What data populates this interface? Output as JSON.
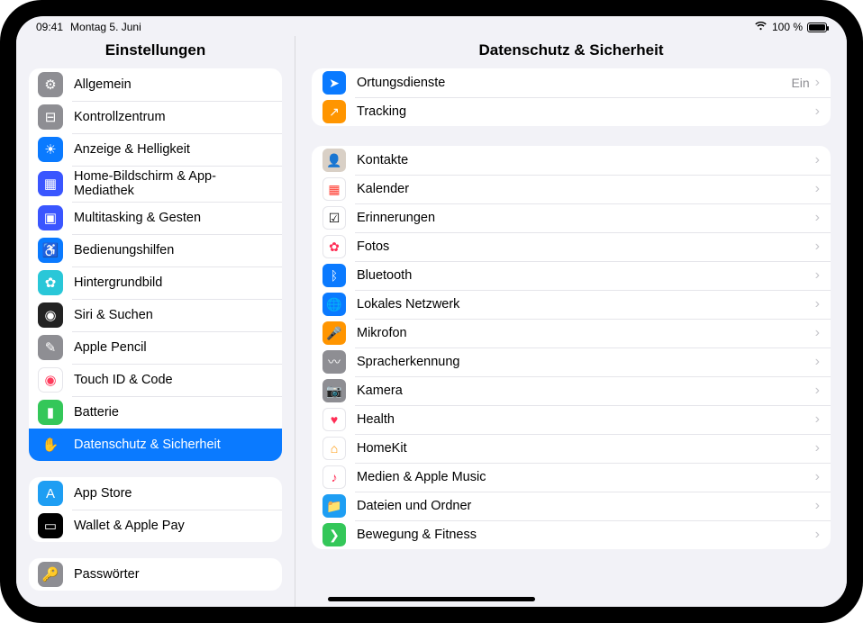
{
  "statusbar": {
    "time": "09:41",
    "date": "Montag 5. Juni",
    "battery_text": "100 %"
  },
  "sidebar": {
    "title": "Einstellungen",
    "groups": [
      {
        "rows": [
          {
            "key": "general",
            "label": "Allgemein",
            "icon_bg": "#8e8e93",
            "glyph": "⚙"
          },
          {
            "key": "control-center",
            "label": "Kontrollzentrum",
            "icon_bg": "#8e8e93",
            "glyph": "⊟"
          },
          {
            "key": "display",
            "label": "Anzeige & Helligkeit",
            "icon_bg": "#0a7aff",
            "glyph": "☀"
          },
          {
            "key": "home-screen",
            "label": "Home-Bildschirm & App-Mediathek",
            "icon_bg": "#3a56ff",
            "glyph": "▦"
          },
          {
            "key": "multitasking",
            "label": "Multitasking & Gesten",
            "icon_bg": "#3a56ff",
            "glyph": "▣"
          },
          {
            "key": "accessibility",
            "label": "Bedienungshilfen",
            "icon_bg": "#0a7aff",
            "glyph": "♿"
          },
          {
            "key": "wallpaper",
            "label": "Hintergrundbild",
            "icon_bg": "#29c7d8",
            "glyph": "✿"
          },
          {
            "key": "siri",
            "label": "Siri & Suchen",
            "icon_bg": "#222",
            "glyph": "◉"
          },
          {
            "key": "apple-pencil",
            "label": "Apple Pencil",
            "icon_bg": "#8e8e93",
            "glyph": "✎"
          },
          {
            "key": "touchid",
            "label": "Touch ID & Code",
            "icon_bg": "#ffffff",
            "icon_fg": "#ff3b5c",
            "glyph": "◉",
            "border": true
          },
          {
            "key": "battery",
            "label": "Batterie",
            "icon_bg": "#34c759",
            "glyph": "▮"
          },
          {
            "key": "privacy",
            "label": "Datenschutz & Sicherheit",
            "icon_bg": "#0a7aff",
            "glyph": "✋",
            "selected": true
          }
        ]
      },
      {
        "rows": [
          {
            "key": "appstore",
            "label": "App Store",
            "icon_bg": "#1e9ef3",
            "glyph": "A"
          },
          {
            "key": "wallet",
            "label": "Wallet & Apple Pay",
            "icon_bg": "#000",
            "glyph": "▭"
          }
        ]
      },
      {
        "rows": [
          {
            "key": "passwords",
            "label": "Passwörter",
            "icon_bg": "#8e8e93",
            "glyph": "🔑"
          }
        ]
      }
    ]
  },
  "main": {
    "title": "Datenschutz & Sicherheit",
    "groups": [
      {
        "rows": [
          {
            "key": "location",
            "label": "Ortungsdienste",
            "value": "Ein",
            "icon_bg": "#0a7aff",
            "glyph": "➤"
          },
          {
            "key": "tracking",
            "label": "Tracking",
            "icon_bg": "#ff9500",
            "glyph": "↗"
          }
        ]
      },
      {
        "rows": [
          {
            "key": "contacts",
            "label": "Kontakte",
            "icon_bg": "#d9d0c6",
            "glyph": "👤"
          },
          {
            "key": "calendar",
            "label": "Kalender",
            "icon_bg": "#ffffff",
            "icon_fg": "#ff3b30",
            "glyph": "▦",
            "border": true
          },
          {
            "key": "reminders",
            "label": "Erinnerungen",
            "icon_bg": "#ffffff",
            "icon_fg": "#000",
            "glyph": "☑",
            "border": true
          },
          {
            "key": "photos",
            "label": "Fotos",
            "icon_bg": "#ffffff",
            "icon_fg": "#ff2d55",
            "glyph": "✿",
            "border": true
          },
          {
            "key": "bluetooth",
            "label": "Bluetooth",
            "icon_bg": "#0a7aff",
            "glyph": "ᛒ"
          },
          {
            "key": "localnet",
            "label": "Lokales Netzwerk",
            "icon_bg": "#0a7aff",
            "glyph": "🌐"
          },
          {
            "key": "microphone",
            "label": "Mikrofon",
            "icon_bg": "#ff9500",
            "glyph": "🎤"
          },
          {
            "key": "speech",
            "label": "Spracherkennung",
            "icon_bg": "#8e8e93",
            "glyph": "〰"
          },
          {
            "key": "camera",
            "label": "Kamera",
            "icon_bg": "#8e8e93",
            "glyph": "📷"
          },
          {
            "key": "health",
            "label": "Health",
            "icon_bg": "#ffffff",
            "icon_fg": "#ff2d55",
            "glyph": "♥",
            "border": true
          },
          {
            "key": "homekit",
            "label": "HomeKit",
            "icon_bg": "#ffffff",
            "icon_fg": "#ff9500",
            "glyph": "⌂",
            "border": true
          },
          {
            "key": "media",
            "label": "Medien & Apple Music",
            "icon_bg": "#ffffff",
            "icon_fg": "#ff2d55",
            "glyph": "♪",
            "border": true
          },
          {
            "key": "files",
            "label": "Dateien und Ordner",
            "icon_bg": "#1e9ef3",
            "glyph": "📁"
          },
          {
            "key": "motion",
            "label": "Bewegung & Fitness",
            "icon_bg": "#34c759",
            "glyph": "❯"
          }
        ]
      }
    ]
  }
}
